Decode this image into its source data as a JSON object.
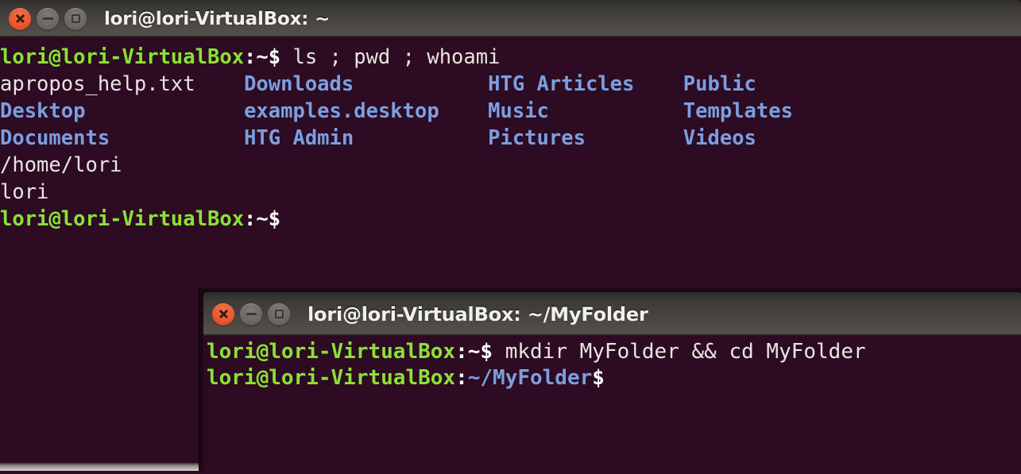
{
  "window1": {
    "title": "lori@lori-VirtualBox: ~",
    "controls": {
      "close_label": "close-icon",
      "minimize_label": "minimize-icon",
      "maximize_label": "maximize-icon"
    },
    "terminal": {
      "prompt_user_host": "lori@lori-VirtualBox",
      "prompt_path": ":~$",
      "command": " ls ; pwd ; whoami",
      "ls_rows": [
        [
          "apropos_help.txt",
          "Downloads",
          "HTG Articles",
          "Public"
        ],
        [
          "Desktop",
          "examples.desktop",
          "Music",
          "Templates"
        ],
        [
          "Documents",
          "HTG Admin",
          "Pictures",
          "Videos"
        ]
      ],
      "ls_row0_col0_is_file": true,
      "pwd_output": "/home/lori",
      "whoami_output": "lori",
      "final_prompt_user_host": "lori@lori-VirtualBox",
      "final_prompt_path": ":~$"
    }
  },
  "window2": {
    "title": "lori@lori-VirtualBox: ~/MyFolder",
    "controls": {
      "close_label": "close-icon",
      "minimize_label": "minimize-icon",
      "maximize_label": "maximize-icon"
    },
    "terminal": {
      "prompt_user_host": "lori@lori-VirtualBox",
      "prompt_path": ":~$",
      "command": " mkdir MyFolder && cd MyFolder",
      "final_prompt_user_host": "lori@lori-VirtualBox",
      "final_prompt_colon": ":",
      "final_prompt_path": "~/MyFolder",
      "final_prompt_sigil": "$"
    }
  },
  "colors": {
    "terminal_bg": "#2d0b22",
    "prompt_green": "#8ae234",
    "dir_blue": "#7b9fe0",
    "text_white": "#e8e5e2",
    "titlebar_gray": "#4d4a45",
    "close_orange": "#e8552c"
  }
}
